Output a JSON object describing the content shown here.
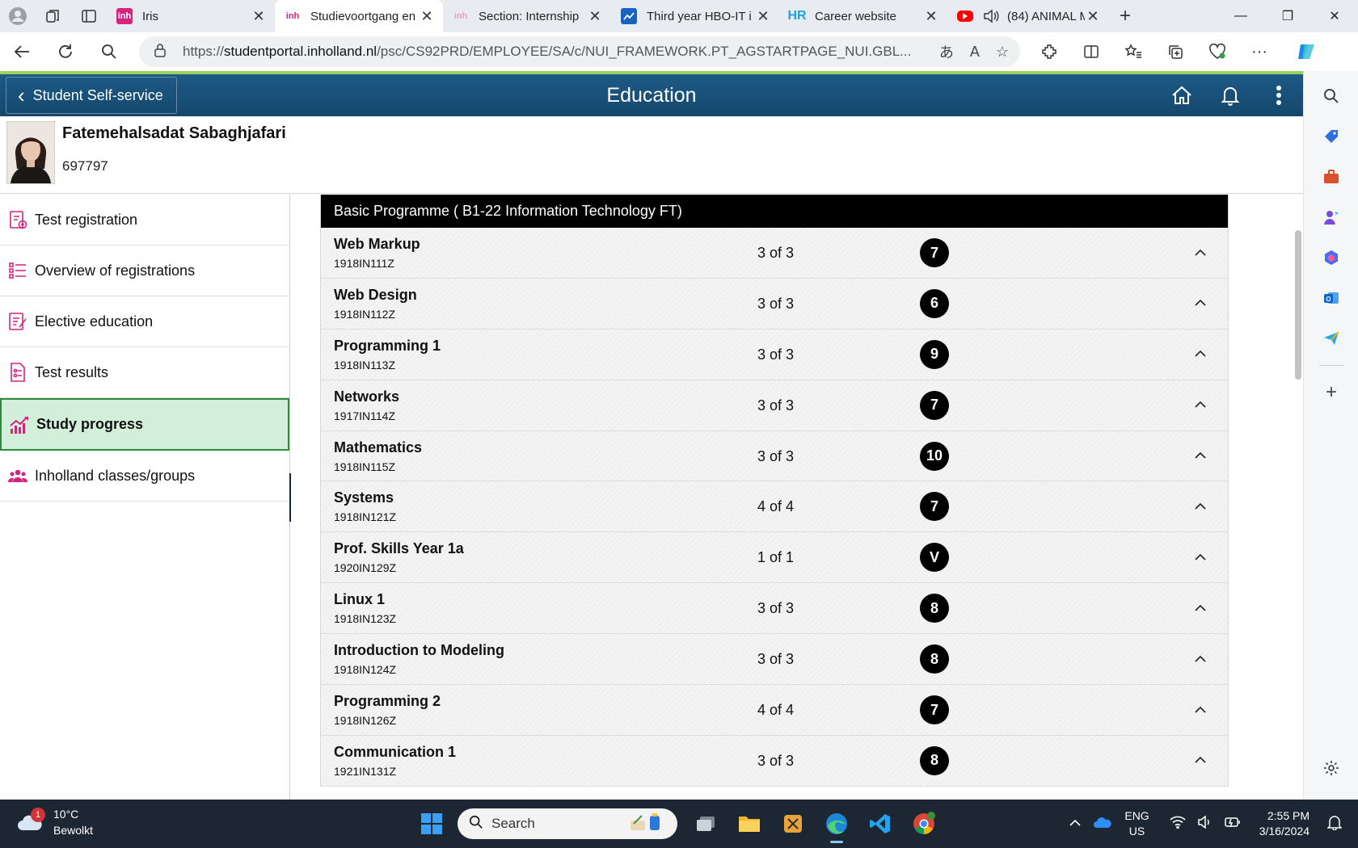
{
  "browser": {
    "tabs": [
      {
        "title": "Iris",
        "favicon": "inholland-favicon",
        "active": false
      },
      {
        "title": "Studievoortgang en",
        "favicon": "inholland-favicon",
        "active": true
      },
      {
        "title": "Section: Internship",
        "favicon": "inholland-favicon-faded",
        "active": false
      },
      {
        "title": "Third year HBO-IT i",
        "favicon": "chart-favicon",
        "active": false
      },
      {
        "title": "Career website",
        "favicon": "hr-favicon",
        "active": false
      },
      {
        "title": "(84) ANIMAL M",
        "favicon": "youtube-favicon",
        "active": false
      }
    ],
    "url_prefix": "https://",
    "url_domain": "studentportal.inholland.nl",
    "url_path": "/psc/CS92PRD/EMPLOYEE/SA/c/NUI_FRAMEWORK.PT_AGSTARTPAGE_NUI.GBL..."
  },
  "app": {
    "back_label": "Student Self-service",
    "title": "Education"
  },
  "profile": {
    "name": "Fatemehalsadat Sabaghjafari",
    "id": "697797"
  },
  "nav": {
    "items": [
      {
        "label": "Test registration",
        "icon": "test-registration-icon"
      },
      {
        "label": "Overview of registrations",
        "icon": "list-icon"
      },
      {
        "label": "Elective education",
        "icon": "elective-icon"
      },
      {
        "label": "Test results",
        "icon": "test-results-icon"
      },
      {
        "label": "Study progress",
        "icon": "chart-up-icon",
        "active": true
      },
      {
        "label": "Inholland classes/groups",
        "icon": "group-icon"
      }
    ]
  },
  "programme": {
    "title": "Basic Programme ( B1-22 Information Technology FT)",
    "courses": [
      {
        "name": "Web Markup",
        "code": "1918IN111Z",
        "count": "3 of 3",
        "grade": "7"
      },
      {
        "name": "Web Design",
        "code": "1918IN112Z",
        "count": "3 of 3",
        "grade": "6"
      },
      {
        "name": "Programming 1",
        "code": "1918IN113Z",
        "count": "3 of 3",
        "grade": "9"
      },
      {
        "name": "Networks",
        "code": "1917IN114Z",
        "count": "3 of 3",
        "grade": "7"
      },
      {
        "name": "Mathematics",
        "code": "1918IN115Z",
        "count": "3 of 3",
        "grade": "10"
      },
      {
        "name": "Systems",
        "code": "1918IN121Z",
        "count": "4 of 4",
        "grade": "7"
      },
      {
        "name": "Prof. Skills Year 1a",
        "code": "1920IN129Z",
        "count": "1 of 1",
        "grade": "V"
      },
      {
        "name": "Linux 1",
        "code": "1918IN123Z",
        "count": "3 of 3",
        "grade": "8"
      },
      {
        "name": "Introduction to Modeling",
        "code": "1918IN124Z",
        "count": "3 of 3",
        "grade": "8"
      },
      {
        "name": "Programming 2",
        "code": "1918IN126Z",
        "count": "4 of 4",
        "grade": "7"
      },
      {
        "name": "Communication 1",
        "code": "1921IN131Z",
        "count": "3 of 3",
        "grade": "8"
      }
    ]
  },
  "taskbar": {
    "weather_temp": "10°C",
    "weather_desc": "Bewolkt",
    "weather_badge": "1",
    "search_placeholder": "Search",
    "lang_line1": "ENG",
    "lang_line2": "US",
    "time": "2:55 PM",
    "date": "3/16/2024"
  },
  "colors": {
    "accent_pink": "#d6247d",
    "header_blue": "#1a5280",
    "active_green": "#d2efda"
  }
}
